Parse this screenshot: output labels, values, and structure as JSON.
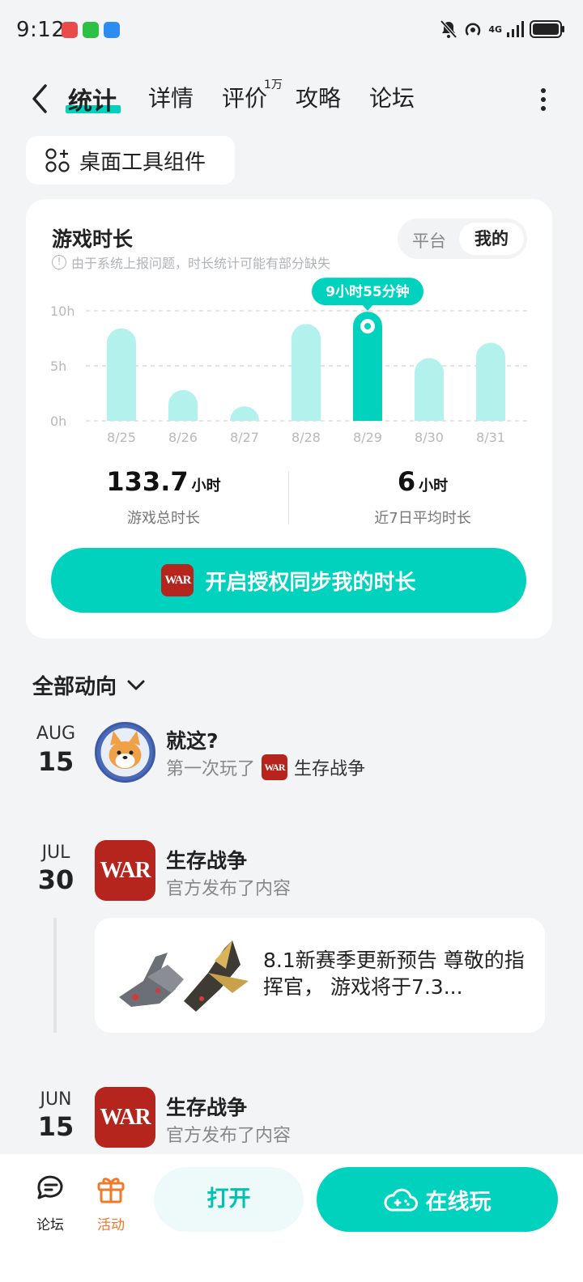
{
  "status": {
    "time": "9:12",
    "network": "4G"
  },
  "header": {
    "tabs": [
      {
        "label": "统计"
      },
      {
        "label": "详情"
      },
      {
        "label": "评价",
        "badge": "1万"
      },
      {
        "label": "攻略"
      },
      {
        "label": "论坛"
      }
    ]
  },
  "widget": {
    "label": "桌面工具组件"
  },
  "stats_card": {
    "title": "游戏时长",
    "note": "由于系统上报问题，时长统计可能有部分缺失",
    "segment": {
      "platform": "平台",
      "mine": "我的",
      "selected": "mine"
    },
    "tooltip": "9小时55分钟",
    "total": {
      "value": "133.7",
      "unit": "小时",
      "label": "游戏总时长"
    },
    "average": {
      "value": "6",
      "unit": "小时",
      "label": "近7日平均时长"
    },
    "sync_button": "开启授权同步我的时长"
  },
  "chart_data": {
    "type": "bar",
    "categories": [
      "8/25",
      "8/26",
      "8/27",
      "8/28",
      "8/29",
      "8/30",
      "8/31"
    ],
    "values": [
      8.4,
      2.8,
      0.5,
      8.8,
      9.92,
      5.7,
      7.1
    ],
    "ylim": [
      0,
      10
    ],
    "y_ticks": [
      "0h",
      "5h",
      "10h"
    ],
    "highlight_index": 4,
    "colors": {
      "bar": "#b3f2ec",
      "highlight": "#00d2be",
      "grid": "#dcdcdc",
      "tick": "#b8b8b8"
    }
  },
  "feed": {
    "filter_label": "全部动向",
    "items": [
      {
        "month": "AUG",
        "day": "15",
        "title": "就这?",
        "sub_prefix": "第一次玩了",
        "game": "生存战争"
      },
      {
        "month": "JUL",
        "day": "30",
        "title": "生存战争",
        "sub": "官方发布了内容",
        "post_text": "8.1新赛季更新预告 尊敬的指挥官， 游戏将于7.3..."
      },
      {
        "month": "JUN",
        "day": "15",
        "title": "生存战争",
        "sub": "官方发布了内容"
      }
    ]
  },
  "game_logo_text": "WAR",
  "bottom_bar": {
    "forum_label": "论坛",
    "activity_label": "活动",
    "open_button": "打开",
    "play_button": "在线玩"
  }
}
